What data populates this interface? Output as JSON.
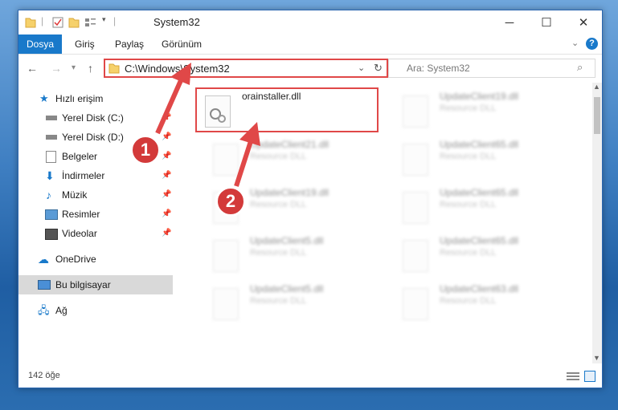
{
  "window": {
    "title": "System32"
  },
  "ribbon": {
    "tabs": [
      "Dosya",
      "Giriş",
      "Paylaş",
      "Görünüm"
    ]
  },
  "address": {
    "path": "C:\\Windows\\System32"
  },
  "search": {
    "placeholder": "Ara: System32"
  },
  "sidebar": {
    "items": [
      {
        "label": "Hızlı erişim",
        "icon": "star-icon"
      },
      {
        "label": "Yerel Disk (C:)",
        "icon": "drive-icon"
      },
      {
        "label": "Yerel Disk (D:)",
        "icon": "drive-icon"
      },
      {
        "label": "Belgeler",
        "icon": "documents-icon"
      },
      {
        "label": "İndirmeler",
        "icon": "download-icon"
      },
      {
        "label": "Müzik",
        "icon": "music-icon"
      },
      {
        "label": "Resimler",
        "icon": "pictures-icon"
      },
      {
        "label": "Videolar",
        "icon": "video-icon"
      },
      {
        "label": "OneDrive",
        "icon": "cloud-icon"
      },
      {
        "label": "Bu bilgisayar",
        "icon": "computer-icon"
      },
      {
        "label": "Ağ",
        "icon": "network-icon"
      }
    ]
  },
  "files": {
    "highlighted": {
      "name": "orainstaller.dll"
    },
    "items": [
      {
        "name": "UpdateClient19.dll",
        "type": "Resource DLL"
      },
      {
        "name": "UpdateClient21.dll",
        "type": "Resource DLL"
      },
      {
        "name": "UpdateClient65.dll",
        "type": "Resource DLL"
      },
      {
        "name": "UpdateClient19.dll",
        "type": "Resource DLL"
      },
      {
        "name": "UpdateClient65.dll",
        "type": "Resource DLL"
      },
      {
        "name": "UpdateClient5.dll",
        "type": "Resource DLL"
      },
      {
        "name": "UpdateClient65.dll",
        "type": "Resource DLL"
      },
      {
        "name": "UpdateClient5.dll",
        "type": "Resource DLL"
      },
      {
        "name": "UpdateClient63.dll",
        "type": "Resource DLL"
      }
    ]
  },
  "status": {
    "count": "142 öğe"
  },
  "annotations": {
    "step1": "1",
    "step2": "2"
  },
  "colors": {
    "accent": "#1979ca",
    "highlight": "#e04848"
  }
}
